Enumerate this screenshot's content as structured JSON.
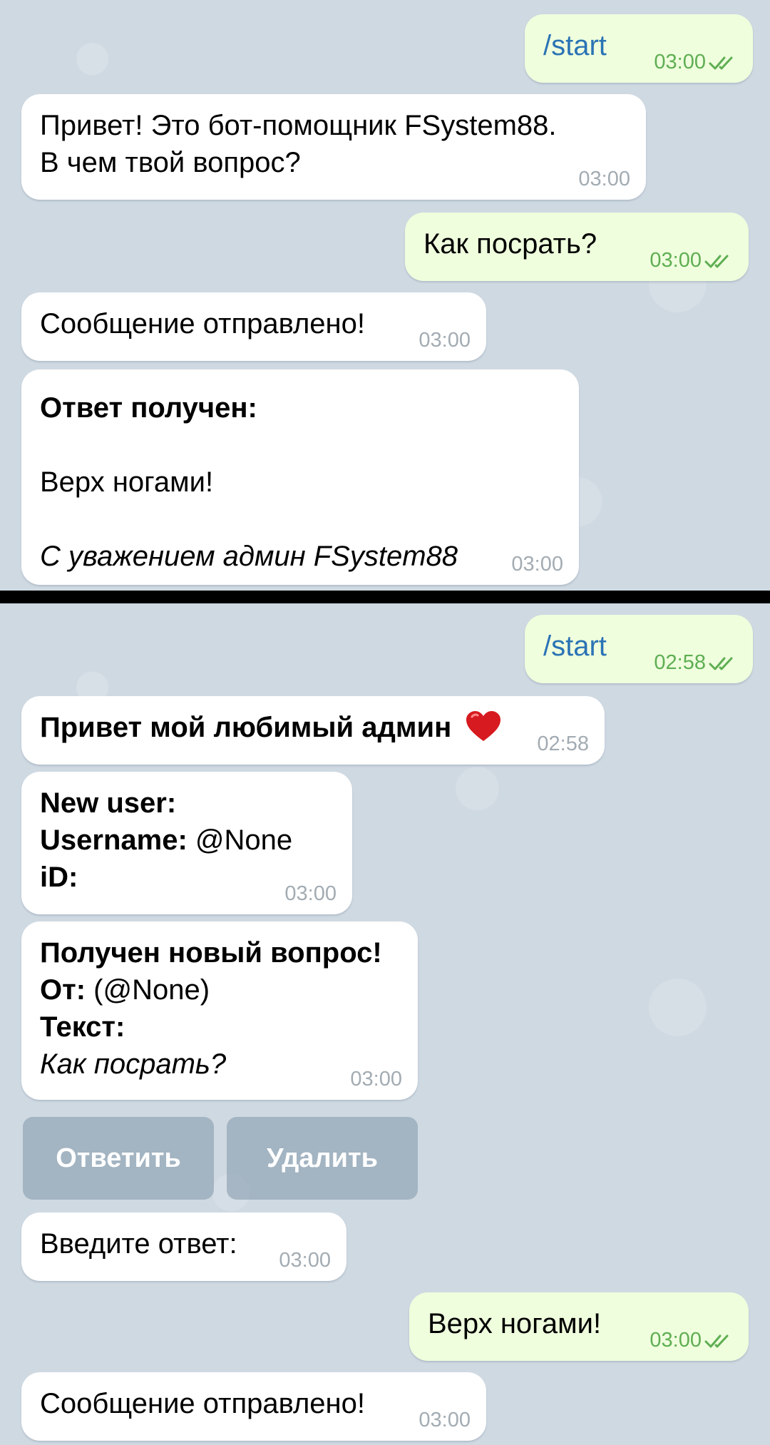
{
  "top_chat": {
    "messages": [
      {
        "dir": "out",
        "text": "/start",
        "time": "03:00"
      },
      {
        "dir": "in",
        "text": "Привет! Это бот-помощник FSystem88.\nВ чем твой вопрос?",
        "time": "03:00"
      },
      {
        "dir": "out",
        "text": "Как посрать?",
        "time": "03:00"
      },
      {
        "dir": "in",
        "text": "Сообщение отправлено!",
        "time": "03:00"
      },
      {
        "dir": "in",
        "heading": "Ответ получен:",
        "body": "Верх ногами!",
        "signature": "С уважением админ FSystem88",
        "time": "03:00"
      }
    ]
  },
  "bottom_chat": {
    "messages": [
      {
        "dir": "out",
        "text": "/start",
        "time": "02:58"
      },
      {
        "dir": "in",
        "text": "Привет мой любимый админ",
        "emoji": "heart-emoji",
        "time": "02:58"
      },
      {
        "dir": "in",
        "line1": "New user:",
        "line2_label": "Username:",
        "line2_value": " @None",
        "line3_label": "iD:",
        "time": "03:00"
      },
      {
        "dir": "in",
        "line1": "Получен новый вопрос!",
        "line2_label": "От:",
        "line2_value": "  (@None)",
        "line3_label": "Текст:",
        "line4": "Как посрать?",
        "time": "03:00"
      },
      {
        "dir": "in",
        "text": "Введите ответ:",
        "time": "03:00"
      },
      {
        "dir": "out",
        "text": "Верх ногами!",
        "time": "03:00"
      },
      {
        "dir": "in",
        "text": "Сообщение отправлено!",
        "time": "03:00"
      }
    ],
    "inline_buttons": [
      {
        "label": "Ответить"
      },
      {
        "label": "Удалить"
      }
    ]
  },
  "colors": {
    "background": "#cfd9e2",
    "incoming_bubble": "#ffffff",
    "outgoing_bubble": "#effedd",
    "outgoing_time": "#5fae53",
    "command_link": "#2a73b5",
    "inline_button": "#8096a8",
    "divider": "#000000"
  }
}
